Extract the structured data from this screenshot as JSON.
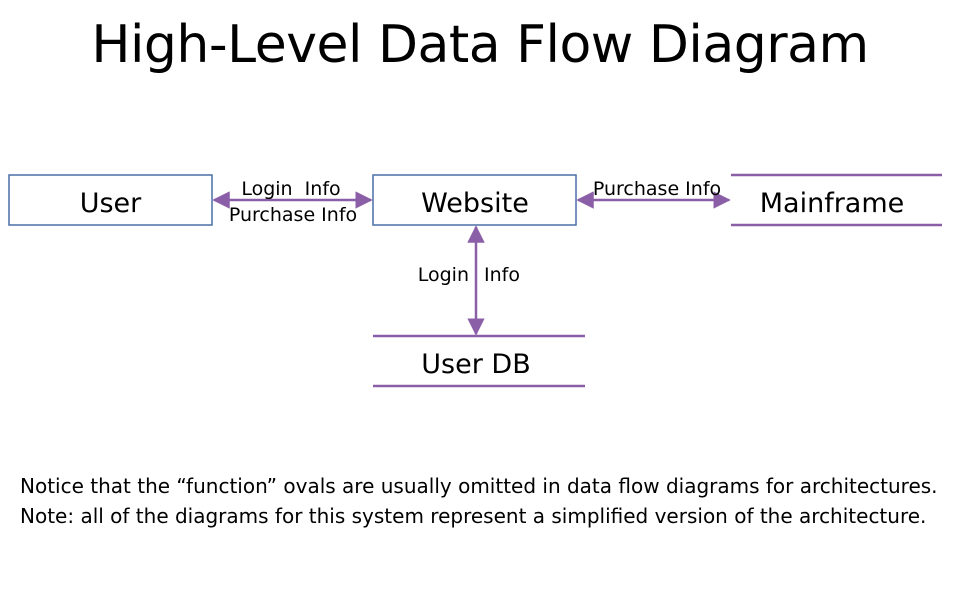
{
  "slide": {
    "title": "High-Level Data Flow Diagram"
  },
  "diagram": {
    "nodes": {
      "user": {
        "label": "User"
      },
      "website": {
        "label": "Website"
      },
      "mainframe": {
        "label": "Mainframe"
      },
      "user_db": {
        "label": "User DB"
      }
    },
    "flows": {
      "user_website": {
        "label_top": "Login  Info",
        "label_bottom": "Purchase Info"
      },
      "website_mainframe": {
        "label": "Purchase Info"
      },
      "website_userdb": {
        "label_left": "Login",
        "label_right": "Info"
      }
    },
    "colors": {
      "process_border": "#4a6fa5",
      "store_line": "#8b5fa8",
      "arrow": "#8b5fa8"
    }
  },
  "notes": {
    "note_1": "Notice that the “function” ovals are usually omitted in data flow diagrams for architectures.",
    "note_2": "Note: all of the diagrams for this system represent a simplified version of the architecture."
  }
}
